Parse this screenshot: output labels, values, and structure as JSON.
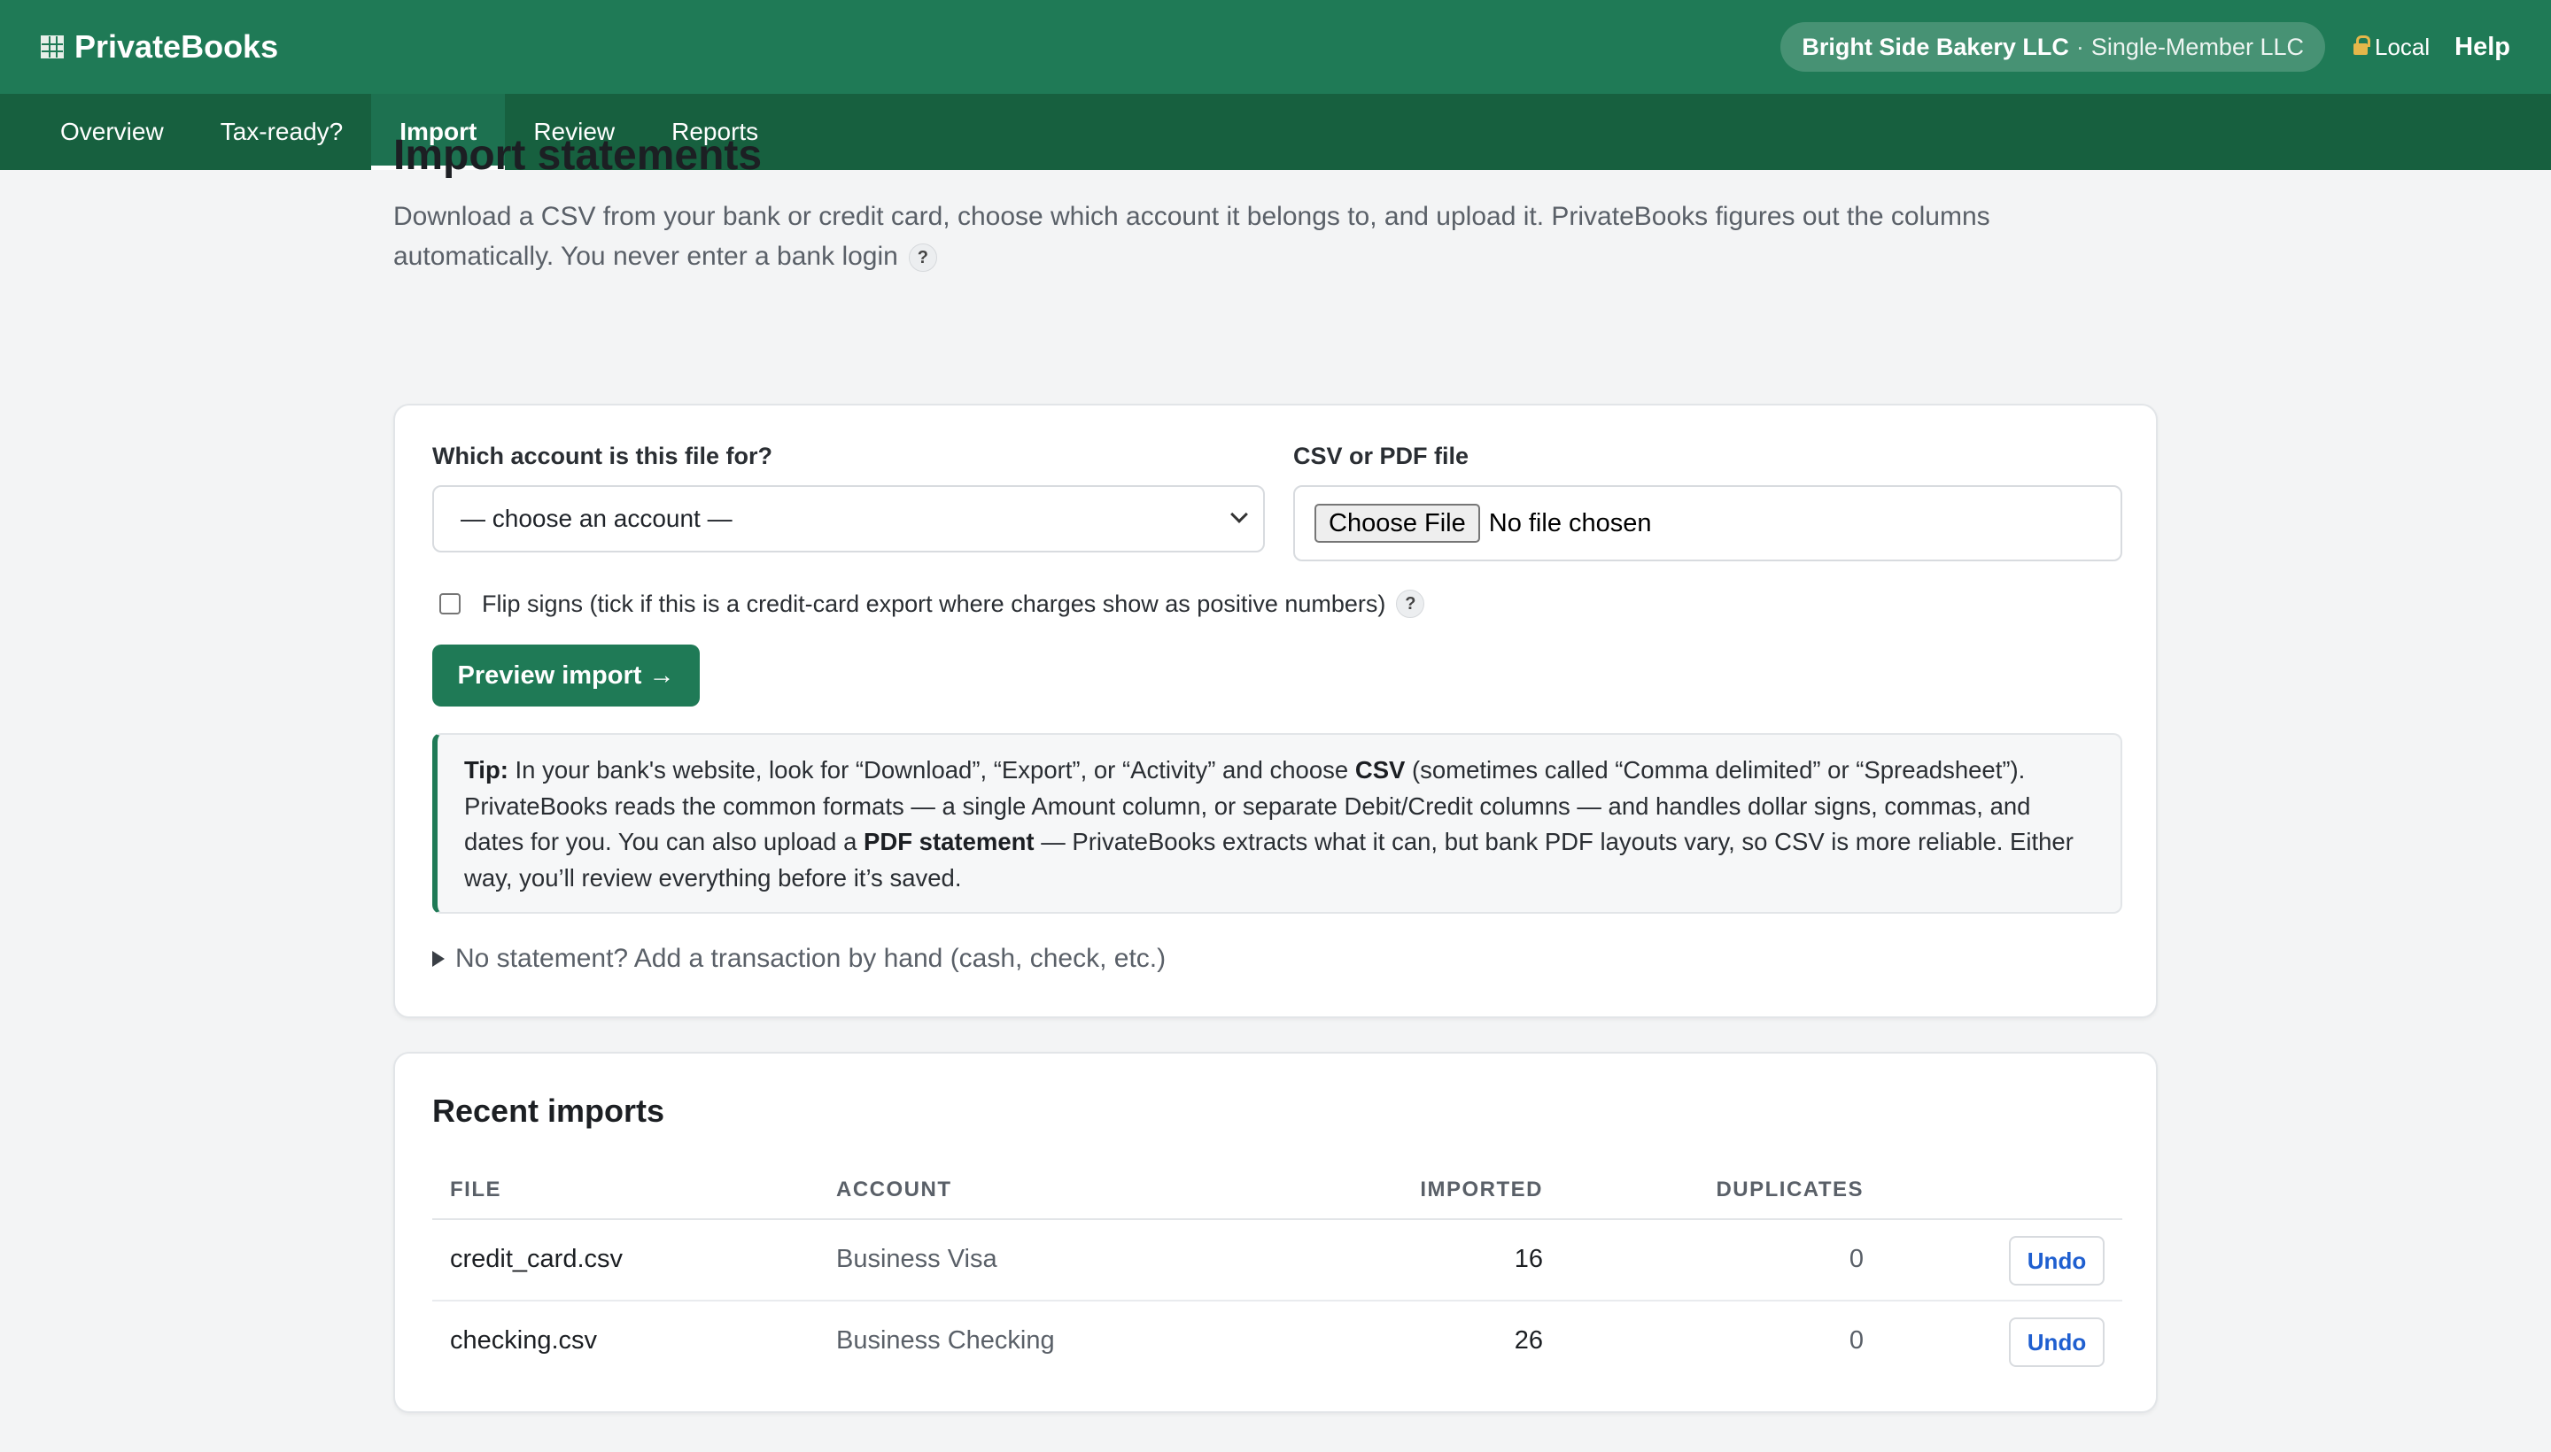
{
  "app": {
    "brand": "PrivateBooks",
    "org_name": "Bright Side Bakery LLC",
    "org_separator": "·",
    "org_type": "Single-Member LLC",
    "local_label": "Local",
    "help_label": "Help"
  },
  "nav": {
    "items": [
      "Overview",
      "Tax-ready?",
      "Import",
      "Review",
      "Reports"
    ],
    "active": "Import"
  },
  "page": {
    "title": "Import statements",
    "intro": "Download a CSV from your bank or credit card, choose which account it belongs to, and upload it. PrivateBooks figures out the columns automatically. You never enter a bank login",
    "help_glyph": "?"
  },
  "import_form": {
    "account_label": "Which account is this file for?",
    "account_selected": "— choose an account —",
    "file_label": "CSV or PDF file",
    "choose_file_label": "Choose File",
    "no_file_text": "No file chosen",
    "flip_signs_label": "Flip signs (tick if this is a credit-card export where charges show as positive numbers)",
    "flip_signs_checked": false,
    "preview_button": "Preview import →",
    "tip_label": "Tip:",
    "tip_part1": "In your bank's website, look for “Download”, “Export”, or “Activity” and choose",
    "tip_csv": "CSV",
    "tip_part2": "(sometimes called “Comma delimited” or “Spreadsheet”). PrivateBooks reads the common formats — a single Amount column, or separate Debit/Credit columns — and handles dollar signs, commas, and dates for you. You can also upload a",
    "tip_pdf": "PDF statement",
    "tip_part3": "— PrivateBooks extracts what it can, but bank PDF layouts vary, so CSV is more reliable. Either way, you’ll review everything before it’s saved.",
    "manual_entry": "No statement? Add a transaction by hand (cash, check, etc.)"
  },
  "recent_imports": {
    "title": "Recent imports",
    "columns": [
      "FILE",
      "ACCOUNT",
      "IMPORTED",
      "DUPLICATES"
    ],
    "rows": [
      {
        "file": "credit_card.csv",
        "account": "Business Visa",
        "imported": "16",
        "duplicates": "0",
        "action": "Undo"
      },
      {
        "file": "checking.csv",
        "account": "Business Checking",
        "imported": "26",
        "duplicates": "0",
        "action": "Undo"
      }
    ]
  },
  "colors": {
    "brand_green": "#1f7a56",
    "nav_green": "#17603f",
    "link_blue": "#1f5fd0",
    "lock": "#e5b74a"
  }
}
